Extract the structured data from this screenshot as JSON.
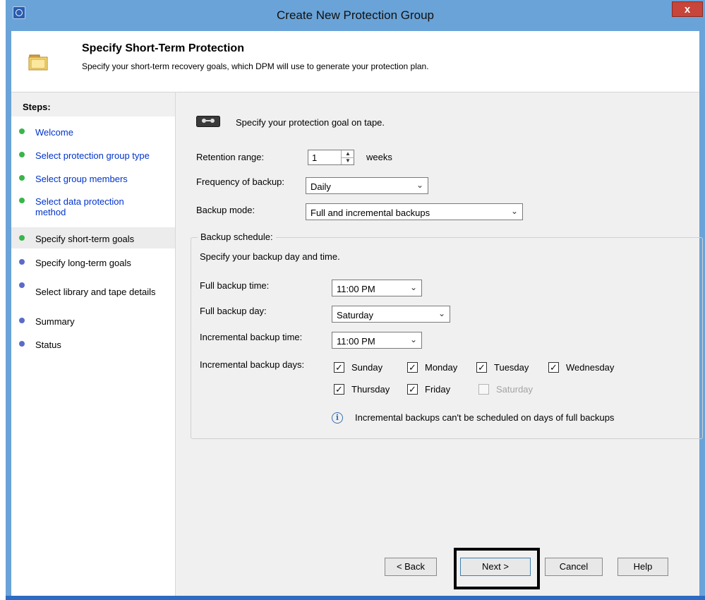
{
  "window": {
    "title": "Create New Protection Group",
    "close_label": "x"
  },
  "header": {
    "title": "Specify Short-Term Protection",
    "description": "Specify your short-term recovery goals, which DPM will use to generate your protection plan."
  },
  "sidebar": {
    "heading": "Steps:",
    "items": [
      {
        "label": "Welcome",
        "status": "done"
      },
      {
        "label": "Select protection group type",
        "status": "done"
      },
      {
        "label": "Select group members",
        "status": "done"
      },
      {
        "label": "Select data protection method",
        "status": "done"
      },
      {
        "label": "Specify short-term goals",
        "status": "current"
      },
      {
        "label": "Specify long-term goals",
        "status": "pending"
      },
      {
        "label": "Select library and tape details",
        "status": "pending"
      },
      {
        "label": "Summary",
        "status": "pending"
      },
      {
        "label": "Status",
        "status": "pending"
      }
    ]
  },
  "main": {
    "goal_text": "Specify your protection goal on tape.",
    "retention_label": "Retention range:",
    "retention_value": "1",
    "retention_unit": "weeks",
    "frequency_label": "Frequency of backup:",
    "frequency_value": "Daily",
    "mode_label": "Backup mode:",
    "mode_value": "Full and incremental backups"
  },
  "schedule": {
    "legend": "Backup schedule:",
    "instruction": "Specify your backup day and time.",
    "full_time_label": "Full backup time:",
    "full_time_value": "11:00 PM",
    "full_day_label": "Full backup day:",
    "full_day_value": "Saturday",
    "inc_time_label": "Incremental backup time:",
    "inc_time_value": "11:00 PM",
    "inc_days_label": "Incremental backup days:",
    "days": [
      {
        "label": "Sunday",
        "checked": true,
        "enabled": true
      },
      {
        "label": "Monday",
        "checked": true,
        "enabled": true
      },
      {
        "label": "Tuesday",
        "checked": true,
        "enabled": true
      },
      {
        "label": "Wednesday",
        "checked": true,
        "enabled": true
      },
      {
        "label": "Thursday",
        "checked": true,
        "enabled": true
      },
      {
        "label": "Friday",
        "checked": true,
        "enabled": true
      },
      {
        "label": "Saturday",
        "checked": false,
        "enabled": false
      }
    ],
    "info_text": "Incremental backups can't be scheduled on days of full backups"
  },
  "buttons": {
    "back": "< Back",
    "next": "Next >",
    "cancel": "Cancel",
    "help": "Help"
  },
  "colors": {
    "title_bar": "#6aa3d8",
    "link": "#0033cc",
    "done_dot": "#39b54a",
    "pending_dot": "#5b6bc8",
    "highlight_border": "#000000"
  },
  "icons": {
    "app": "dpm-clock-icon",
    "header": "folder-icon",
    "tape": "tape-icon",
    "info": "info-icon"
  }
}
